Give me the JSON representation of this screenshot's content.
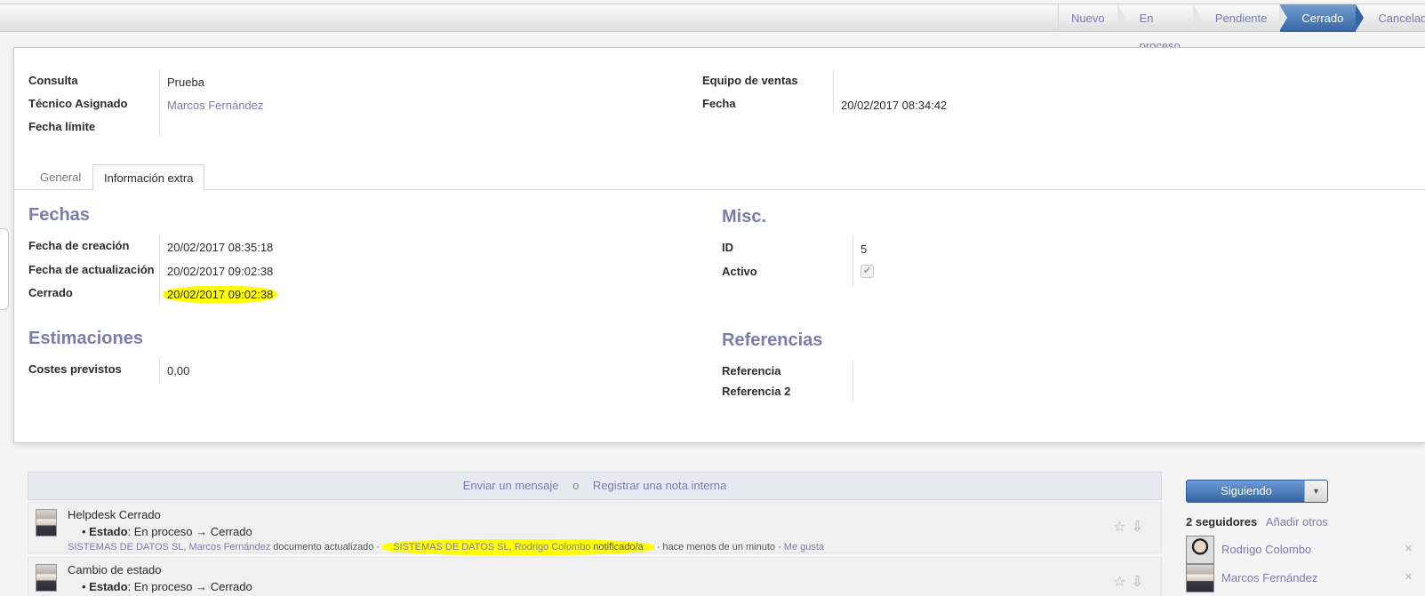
{
  "statusbar": {
    "stages": [
      "Nuevo",
      "En proceso",
      "Pendiente",
      "Cerrado",
      "Cancelado"
    ],
    "active": "Cerrado"
  },
  "header": {
    "consulta_label": "Consulta",
    "consulta_value": "Prueba",
    "tecnico_label": "Técnico Asignado",
    "tecnico_value": "Marcos Fernández",
    "fecha_limite_label": "Fecha límite",
    "equipo_label": "Equipo de ventas",
    "fecha_label": "Fecha",
    "fecha_value": "20/02/2017 08:34:42"
  },
  "tabs": [
    "General",
    "Información extra"
  ],
  "fechas": {
    "title": "Fechas",
    "creacion_label": "Fecha de creación",
    "creacion_value": "20/02/2017 08:35:18",
    "actualizacion_label": "Fecha de actualización",
    "actualizacion_value": "20/02/2017 09:02:38",
    "cerrado_label": "Cerrado",
    "cerrado_value": "20/02/2017 09:02:38"
  },
  "misc": {
    "title": "Misc.",
    "id_label": "ID",
    "id_value": "5",
    "activo_label": "Activo",
    "activo_checked": true
  },
  "estimaciones": {
    "title": "Estimaciones",
    "costes_label": "Costes previstos",
    "costes_value": "0,00"
  },
  "referencias": {
    "title": "Referencias",
    "ref_label": "Referencia",
    "ref2_label": "Referencia 2"
  },
  "composer": {
    "send": "Enviar un mensaje",
    "or": "o",
    "note": "Registrar una nota interna"
  },
  "messages": [
    {
      "title": "Helpdesk Cerrado",
      "field": "Estado",
      "change": ": En proceso → Cerrado",
      "authors": "SISTEMAS DE DATOS SL, Marcos Fernández",
      "action": " documento actualizado · ",
      "notified": "SISTEMAS DE DATOS SL, Rodrigo Colombo",
      "notified_suffix": " notificado/a",
      "time": " · hace menos de un minuto · ",
      "like": "Me gusta"
    },
    {
      "title": "Cambio de estado",
      "field": "Estado",
      "change": ": En proceso → Cerrado"
    }
  ],
  "followers": {
    "button": "Siguiendo",
    "count": "2 seguidores",
    "add": "Añadir otros",
    "list": [
      "Rodrigo Colombo",
      "Marcos Fernández"
    ],
    "remove": "×"
  },
  "icons": {
    "star": "star-icon",
    "download": "download-icon",
    "caret": "caret-down-icon",
    "check": "check-icon"
  }
}
